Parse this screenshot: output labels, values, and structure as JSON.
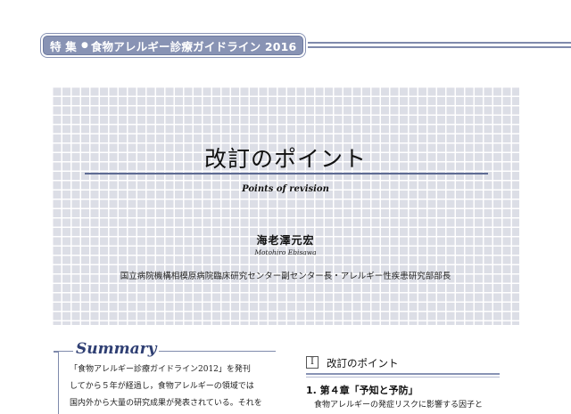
{
  "header": {
    "label": "特 集",
    "dot": "●",
    "title": "食物アレルギー診療ガイドライン 2016"
  },
  "article": {
    "title": "改訂のポイント",
    "subtitle": "Points of revision",
    "author": "海老澤元宏",
    "author_roman": "Motohiro Ebisawa",
    "affiliation": "国立病院機構相模原病院臨床研究センター副センター長・アレルギー性疾患研究部部長"
  },
  "summary": {
    "label": "Summary",
    "lines": [
      "「食物アレルギー診療ガイドライン2012」を発刊",
      "してから５年が経過し，食物アレルギーの領域では",
      "国内外から大量の研究成果が発表されている。それを"
    ]
  },
  "section": {
    "number": "I",
    "title": "改訂のポイント",
    "chapter": "1. 第４章「予知と予防」",
    "body_line": "食物アレルギーの発症リスクに影響する因子と"
  }
}
